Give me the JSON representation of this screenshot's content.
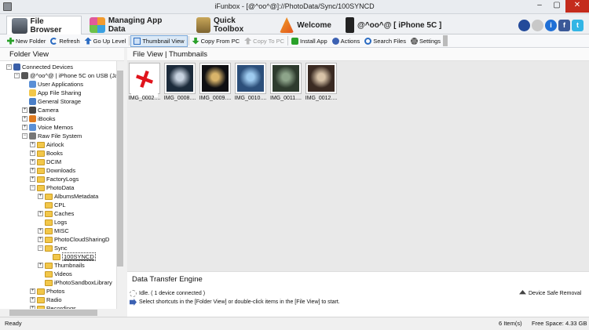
{
  "window": {
    "title": "iFunbox - [@^oo^@]://PhotoData/Sync/100SYNCD",
    "minimize": "–",
    "maximize": "▢",
    "close": "✕"
  },
  "tabs": [
    {
      "label": "File Browser",
      "icon": "file-browser-icon"
    },
    {
      "label": "Managing App Data",
      "icon": "apps-grid-icon"
    },
    {
      "label": "Quick Toolbox",
      "icon": "toolbox-icon"
    },
    {
      "label": "Welcome",
      "icon": "welcome-icon"
    },
    {
      "label": "@^oo^@ [ iPhone 5C ]",
      "icon": "iphone-icon"
    }
  ],
  "social": {
    "globe": "",
    "refresh": "",
    "info": "i",
    "facebook": "f",
    "twitter": "t"
  },
  "toolbar": [
    {
      "label": "New Folder",
      "icon": "new-folder-icon"
    },
    {
      "label": "Refresh",
      "icon": "refresh-icon"
    },
    {
      "label": "Go Up Level",
      "icon": "up-arrow-icon"
    },
    {
      "label": "Thumbnail View",
      "icon": "thumbnail-view-icon"
    },
    {
      "label": "Copy From PC",
      "icon": "copy-from-pc-icon"
    },
    {
      "label": "Copy To PC",
      "icon": "copy-to-pc-icon"
    },
    {
      "label": "Install App",
      "icon": "install-app-icon"
    },
    {
      "label": "Actions",
      "icon": "actions-icon"
    },
    {
      "label": "Search Files",
      "icon": "search-icon"
    },
    {
      "label": "Settings",
      "icon": "gear-icon"
    }
  ],
  "folder_view": {
    "title": "Folder View"
  },
  "file_view": {
    "title": "File View  |  Thumbnails"
  },
  "tree": [
    {
      "label": "Connected Devices",
      "depth": 0,
      "exp": "−",
      "icon": "device-icon"
    },
    {
      "label": "@^oo^@ | iPhone 5C on USB (Ja",
      "depth": 1,
      "exp": "−",
      "icon": "phone-icon"
    },
    {
      "label": "User Applications",
      "depth": 2,
      "exp": "",
      "icon": "app-icon"
    },
    {
      "label": "App File Sharing",
      "depth": 2,
      "exp": "",
      "icon": "sharing-icon"
    },
    {
      "label": "General Storage",
      "depth": 2,
      "exp": "",
      "icon": "storage-icon"
    },
    {
      "label": "Camera",
      "depth": 2,
      "exp": "+",
      "icon": "camera-icon"
    },
    {
      "label": "iBooks",
      "depth": 2,
      "exp": "+",
      "icon": "ibooks-icon"
    },
    {
      "label": "Voice Memos",
      "depth": 2,
      "exp": "+",
      "icon": "voice-icon"
    },
    {
      "label": "Raw File System",
      "depth": 2,
      "exp": "−",
      "icon": "raw-fs-icon"
    },
    {
      "label": "Airlock",
      "depth": 3,
      "exp": "+",
      "icon": "folder"
    },
    {
      "label": "Books",
      "depth": 3,
      "exp": "+",
      "icon": "folder"
    },
    {
      "label": "DCIM",
      "depth": 3,
      "exp": "+",
      "icon": "folder"
    },
    {
      "label": "Downloads",
      "depth": 3,
      "exp": "+",
      "icon": "folder"
    },
    {
      "label": "FactoryLogs",
      "depth": 3,
      "exp": "+",
      "icon": "folder"
    },
    {
      "label": "PhotoData",
      "depth": 3,
      "exp": "−",
      "icon": "folder"
    },
    {
      "label": "AlbumsMetadata",
      "depth": 4,
      "exp": "+",
      "icon": "folder"
    },
    {
      "label": "CPL",
      "depth": 4,
      "exp": "",
      "icon": "folder"
    },
    {
      "label": "Caches",
      "depth": 4,
      "exp": "+",
      "icon": "folder"
    },
    {
      "label": "Logs",
      "depth": 4,
      "exp": "",
      "icon": "folder"
    },
    {
      "label": "MISC",
      "depth": 4,
      "exp": "+",
      "icon": "folder"
    },
    {
      "label": "PhotoCloudSharingD",
      "depth": 4,
      "exp": "+",
      "icon": "folder"
    },
    {
      "label": "Sync",
      "depth": 4,
      "exp": "−",
      "icon": "folder"
    },
    {
      "label": "100SYNCD",
      "depth": 5,
      "exp": "",
      "icon": "folder",
      "selected": true
    },
    {
      "label": "Thumbnails",
      "depth": 4,
      "exp": "+",
      "icon": "folder"
    },
    {
      "label": "Videos",
      "depth": 4,
      "exp": "",
      "icon": "folder"
    },
    {
      "label": "iPhotoSandboxLibrary",
      "depth": 4,
      "exp": "",
      "icon": "folder"
    },
    {
      "label": "Photos",
      "depth": 3,
      "exp": "+",
      "icon": "folder"
    },
    {
      "label": "Radio",
      "depth": 3,
      "exp": "+",
      "icon": "folder"
    },
    {
      "label": "Recordings",
      "depth": 3,
      "exp": "+",
      "icon": "folder"
    }
  ],
  "files": [
    {
      "name": "IMG_0002....",
      "bg": "#ffffff",
      "accent": "#e0141c"
    },
    {
      "name": "IMG_0008....",
      "bg": "#1b2a3a",
      "accent": "#c7d2e0"
    },
    {
      "name": "IMG_0009....",
      "bg": "#0f0f12",
      "accent": "#d9b46a"
    },
    {
      "name": "IMG_0010....",
      "bg": "#2c4f7a",
      "accent": "#9ecbf0"
    },
    {
      "name": "IMG_0011....",
      "bg": "#2e3b2e",
      "accent": "#8da48a"
    },
    {
      "name": "IMG_0012....",
      "bg": "#3a2a22",
      "accent": "#d8c3a8"
    }
  ],
  "transfer": {
    "title": "Data Transfer Engine",
    "status": "Idle. ( 1 device connected )",
    "hint": "Select shortcuts in the [Folder View] or double-click items in the [File View] to start.",
    "safe_removal": "Device Safe Removal"
  },
  "status": {
    "left": "Ready",
    "items": "6 Item(s)",
    "free": "Free Space: 4.33 GB"
  }
}
